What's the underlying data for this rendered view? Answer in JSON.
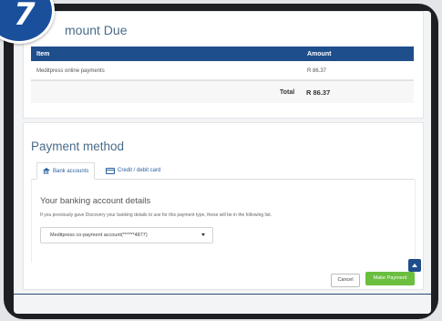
{
  "step_badge": "7",
  "amount_due": {
    "title": "mount Due",
    "columns": {
      "item": "Item",
      "amount": "Amount"
    },
    "rows": [
      {
        "item": "Meditpress online payments",
        "amount": "R 86.37"
      }
    ],
    "total_label": "Total",
    "total_value": "R 86.37"
  },
  "payment": {
    "title": "Payment method",
    "tabs": [
      {
        "label": "Bank accounts",
        "icon": "bank-icon",
        "active": true
      },
      {
        "label": "Credit / debit card",
        "icon": "credit-card-icon",
        "active": false
      }
    ],
    "details_heading": "Your banking account details",
    "help_text": "If you previously gave Discovery your banking details to use for this payment type, these will be in the following list.",
    "account_selected": "Meditpress co-payment account(******4877)",
    "cancel_label": "Cancel",
    "pay_label": "Make Payment"
  },
  "colors": {
    "header_blue": "#1f4e8c",
    "pay_green": "#6bbf3f",
    "title_blue": "#4a6b8a"
  }
}
